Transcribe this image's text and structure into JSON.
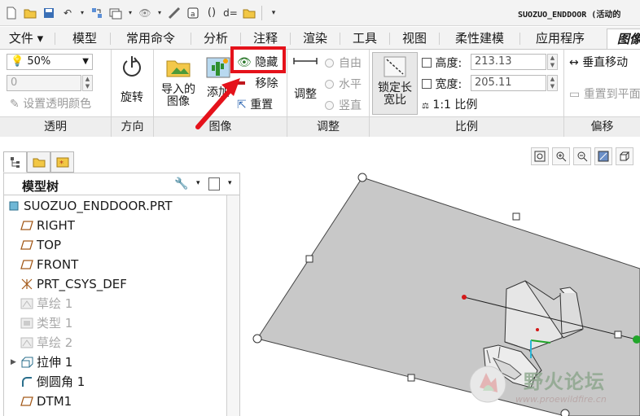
{
  "window": {
    "title": "SUOZUO_ENDDOOR (活动的"
  },
  "tabs": [
    {
      "label": "文件 ▾"
    },
    {
      "label": "模型"
    },
    {
      "label": "常用命令"
    },
    {
      "label": "分析"
    },
    {
      "label": "注释"
    },
    {
      "label": "渲染"
    },
    {
      "label": "工具"
    },
    {
      "label": "视图"
    },
    {
      "label": "柔性建模"
    },
    {
      "label": "应用程序"
    },
    {
      "label": "图像"
    }
  ],
  "ribbon": {
    "transparency": {
      "value": "50%",
      "input": "0",
      "set_color": "设置透明颜色",
      "group": "透明"
    },
    "orientation": {
      "rotate": "旋转",
      "group": "方向"
    },
    "image": {
      "import": "导入的\n图像",
      "add": "添加",
      "hide": "隐藏",
      "remove": "移除",
      "reset": "重置",
      "group": "图像"
    },
    "adjust": {
      "adjust": "调整",
      "free": "自由",
      "horizontal": "水平",
      "vertical": "竖直",
      "group": "调整"
    },
    "scale": {
      "lock": "锁定长\n宽比",
      "height_label": "高度:",
      "height_value": "213.13",
      "width_label": "宽度:",
      "width_value": "205.11",
      "ratio_label": "1:1 比例",
      "group": "比例"
    },
    "offset": {
      "vmove": "垂直移动",
      "reset_plane": "重置到平面",
      "group": "偏移"
    }
  },
  "model_tree": {
    "title": "模型树",
    "items": [
      {
        "label": "SUOZUO_ENDDOOR.PRT",
        "icon": "part-icon",
        "dim": false,
        "indent": 0
      },
      {
        "label": "RIGHT",
        "icon": "datum-plane-icon",
        "dim": false,
        "indent": 1
      },
      {
        "label": "TOP",
        "icon": "datum-plane-icon",
        "dim": false,
        "indent": 1
      },
      {
        "label": "FRONT",
        "icon": "datum-plane-icon",
        "dim": false,
        "indent": 1
      },
      {
        "label": "PRT_CSYS_DEF",
        "icon": "csys-icon",
        "dim": false,
        "indent": 1
      },
      {
        "label": "草绘 1",
        "icon": "sketch-icon",
        "dim": true,
        "indent": 1
      },
      {
        "label": "类型 1",
        "icon": "type-icon",
        "dim": true,
        "indent": 1
      },
      {
        "label": "草绘 2",
        "icon": "sketch-icon",
        "dim": true,
        "indent": 1
      },
      {
        "label": "拉伸 1",
        "icon": "extrude-icon",
        "dim": false,
        "indent": 1,
        "expandable": true
      },
      {
        "label": "倒圆角 1",
        "icon": "round-icon",
        "dim": false,
        "indent": 1
      },
      {
        "label": "DTM1",
        "icon": "datum-plane-icon",
        "dim": false,
        "indent": 1
      }
    ]
  },
  "watermark": {
    "text": "野火论坛",
    "url": "www.proewildfire.cn"
  },
  "colors": {
    "accent_red": "#e5121b",
    "plane_gray": "#c8c8c8",
    "handle_green": "#21a62a"
  }
}
